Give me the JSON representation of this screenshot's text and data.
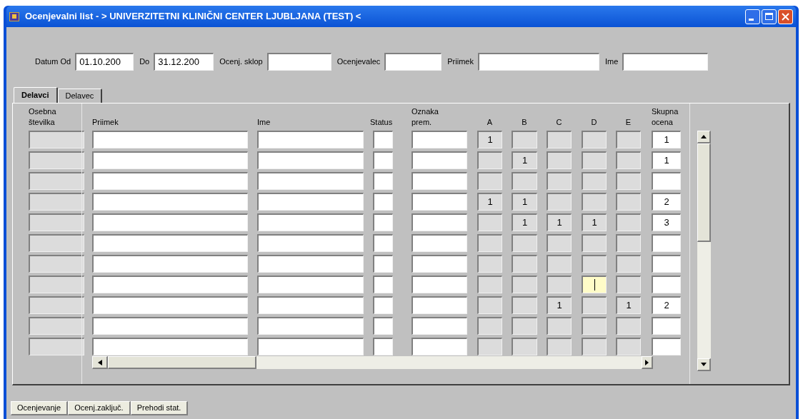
{
  "window": {
    "title": "Ocenjevalni list - > UNIVERZITETNI KLINIČNI CENTER LJUBLJANA (TEST) <"
  },
  "filters": [
    {
      "label": "Datum Od",
      "value": "01.10.200"
    },
    {
      "label": "Do",
      "value": "31.12.200"
    },
    {
      "label": "Ocenj. sklop"
    },
    {
      "label": "Ocenjevalec"
    },
    {
      "label": "Priimek"
    },
    {
      "label": "Ime"
    }
  ],
  "tabs": [
    {
      "label": "Delavci",
      "selected": true
    },
    {
      "label": "Delavec",
      "selected": false
    }
  ],
  "table": {
    "columns": [
      "Osebna številka",
      "Priimek",
      "Ime",
      "Status",
      "Oznaka prem.",
      "A",
      "B",
      "C",
      "D",
      "E",
      "Skupna ocena"
    ],
    "rows": [
      {
        "grades": [
          {
            "value": "1",
            "focused": false
          },
          {
            "focused": false
          },
          {
            "focused": false
          },
          {
            "focused": false
          },
          {
            "focused": false
          }
        ],
        "total": "1"
      },
      {
        "grades": [
          {
            "focused": false
          },
          {
            "value": "1",
            "focused": false
          },
          {
            "focused": false
          },
          {
            "focused": false
          },
          {
            "focused": false
          }
        ],
        "total": "1"
      },
      {
        "grades": [
          {
            "focused": false
          },
          {
            "focused": false
          },
          {
            "focused": false
          },
          {
            "focused": false
          },
          {
            "focused": false
          }
        ]
      },
      {
        "grades": [
          {
            "value": "1",
            "focused": false
          },
          {
            "value": "1",
            "focused": false
          },
          {
            "focused": false
          },
          {
            "focused": false
          },
          {
            "focused": false
          }
        ],
        "total": "2"
      },
      {
        "grades": [
          {
            "focused": false
          },
          {
            "value": "1",
            "focused": false
          },
          {
            "value": "1",
            "focused": false
          },
          {
            "value": "1",
            "focused": false
          },
          {
            "focused": false
          }
        ],
        "total": "3"
      },
      {
        "grades": [
          {
            "focused": false
          },
          {
            "focused": false
          },
          {
            "focused": false
          },
          {
            "focused": false
          },
          {
            "focused": false
          }
        ]
      },
      {
        "grades": [
          {
            "focused": false
          },
          {
            "focused": false
          },
          {
            "focused": false
          },
          {
            "focused": false
          },
          {
            "focused": false
          }
        ]
      },
      {
        "grades": [
          {
            "focused": false
          },
          {
            "focused": false
          },
          {
            "focused": false
          },
          {
            "focused": true
          },
          {
            "focused": false
          }
        ]
      },
      {
        "grades": [
          {
            "focused": false
          },
          {
            "focused": false
          },
          {
            "value": "1",
            "focused": false
          },
          {
            "focused": false
          },
          {
            "value": "1",
            "focused": false
          }
        ],
        "total": "2"
      },
      {
        "grades": [
          {
            "focused": false
          },
          {
            "focused": false
          },
          {
            "focused": false
          },
          {
            "focused": false
          },
          {
            "focused": false
          }
        ]
      },
      {
        "grades": [
          {
            "focused": false
          },
          {
            "focused": false
          },
          {
            "focused": false
          },
          {
            "focused": false
          },
          {
            "focused": false
          }
        ]
      }
    ]
  },
  "buttons": [
    "Ocenjevanje",
    "Ocenj.zaključ.",
    "Prehodi stat."
  ]
}
